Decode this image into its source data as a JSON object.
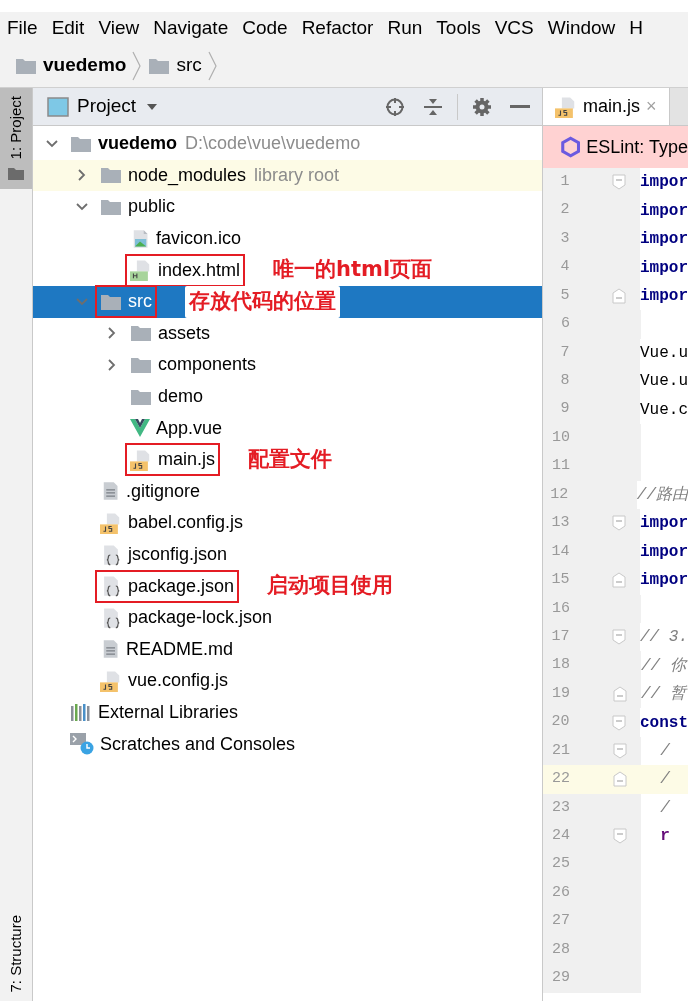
{
  "menu": [
    "File",
    "Edit",
    "View",
    "Navigate",
    "Code",
    "Refactor",
    "Run",
    "Tools",
    "VCS",
    "Window",
    "H"
  ],
  "breadcrumb": [
    {
      "label": "vuedemo",
      "bold": true
    },
    {
      "label": "src",
      "bold": false
    }
  ],
  "side_tabs_top": [
    {
      "label": "1: Project",
      "selected": true
    }
  ],
  "side_tabs_bottom": [
    {
      "label": "7: Structure",
      "selected": false
    }
  ],
  "project_panel": {
    "title": "Project"
  },
  "tree": [
    {
      "label": "vuedemo",
      "kind": "folder",
      "hint": "D:\\code\\vue\\vuedemo",
      "bold": true,
      "expanded": true,
      "selected": false,
      "children": [
        {
          "label": "node_modules",
          "kind": "folder",
          "hint": "library root",
          "expanded": false,
          "selected": false,
          "library": true
        },
        {
          "label": "public",
          "kind": "folder",
          "expanded": true,
          "selected": false,
          "children": [
            {
              "label": "favicon.ico",
              "kind": "image",
              "selected": false
            },
            {
              "label": "index.html",
              "kind": "html",
              "selected": false,
              "note": "唯一的html页面"
            }
          ]
        },
        {
          "label": "src",
          "kind": "folder",
          "expanded": true,
          "selected": true,
          "note": "存放代码的位置",
          "children": [
            {
              "label": "assets",
              "kind": "folder",
              "expanded": false,
              "selected": false
            },
            {
              "label": "components",
              "kind": "folder",
              "expanded": false,
              "selected": false
            },
            {
              "label": "demo",
              "kind": "folder",
              "selected": false
            },
            {
              "label": "App.vue",
              "kind": "vue",
              "selected": false
            },
            {
              "label": "main.js",
              "kind": "js",
              "selected": false,
              "note": "配置文件"
            }
          ]
        },
        {
          "label": ".gitignore",
          "kind": "text",
          "selected": false
        },
        {
          "label": "babel.config.js",
          "kind": "js",
          "selected": false
        },
        {
          "label": "jsconfig.json",
          "kind": "json",
          "selected": false
        },
        {
          "label": "package.json",
          "kind": "json",
          "selected": false,
          "note": "启动项目使用"
        },
        {
          "label": "package-lock.json",
          "kind": "json",
          "selected": false
        },
        {
          "label": "README.md",
          "kind": "text",
          "selected": false
        },
        {
          "label": "vue.config.js",
          "kind": "js",
          "selected": false
        }
      ]
    },
    {
      "label": "External Libraries",
      "kind": "libraries",
      "selected": false
    },
    {
      "label": "Scratches and Consoles",
      "kind": "scratches",
      "selected": false
    }
  ],
  "editor_tab": {
    "label": "main.js",
    "close": "×"
  },
  "eslint_bar": {
    "text": "ESLint: Type"
  },
  "code": [
    {
      "num": "1",
      "text": "impor",
      "kind": "keyword",
      "fold_start": true,
      "current": false
    },
    {
      "num": "2",
      "text": "impor",
      "kind": "keyword",
      "current": false
    },
    {
      "num": "3",
      "text": "impor",
      "kind": "keyword",
      "current": false
    },
    {
      "num": "4",
      "text": "impor",
      "kind": "keyword",
      "current": false
    },
    {
      "num": "5",
      "text": "impor",
      "kind": "keyword",
      "fold_end": true,
      "current": false
    },
    {
      "num": "6",
      "current": false
    },
    {
      "num": "7",
      "text": "Vue.u",
      "kind": "plain",
      "current": false
    },
    {
      "num": "8",
      "text": "Vue.u",
      "kind": "plain",
      "current": false
    },
    {
      "num": "9",
      "text": "Vue.c",
      "kind": "plain",
      "current": false
    },
    {
      "num": "10",
      "current": false
    },
    {
      "num": "11",
      "current": false
    },
    {
      "num": "12",
      "text": "//路由",
      "kind": "comment",
      "current": false
    },
    {
      "num": "13",
      "text": "impor",
      "kind": "keyword",
      "fold_start": true,
      "current": false
    },
    {
      "num": "14",
      "text": "impor",
      "kind": "keyword",
      "current": false
    },
    {
      "num": "15",
      "text": "impor",
      "kind": "keyword",
      "fold_end": true,
      "current": false
    },
    {
      "num": "16",
      "current": false
    },
    {
      "num": "17",
      "text": "// 3.",
      "kind": "comment",
      "fold_start": true,
      "current": false
    },
    {
      "num": "18",
      "text": "// 你",
      "kind": "comment",
      "current": false
    },
    {
      "num": "19",
      "text": "// 暂",
      "kind": "comment",
      "fold_end": true,
      "current": false
    },
    {
      "num": "20",
      "text": "const",
      "kind": "keyword",
      "fold_start": true,
      "current": false
    },
    {
      "num": "21",
      "text": "  /",
      "kind": "comment",
      "fold_start": true,
      "current": false
    },
    {
      "num": "22",
      "text": "  /",
      "kind": "comment",
      "fold_end": true,
      "current": true
    },
    {
      "num": "23",
      "text": "  /",
      "kind": "comment",
      "current": false
    },
    {
      "num": "24",
      "text": "  r",
      "kind": "call",
      "fold_start": true,
      "current": false
    },
    {
      "num": "25",
      "current": false
    },
    {
      "num": "26",
      "current": false
    },
    {
      "num": "27",
      "current": false
    },
    {
      "num": "28",
      "current": false
    },
    {
      "num": "29",
      "current": false
    }
  ]
}
